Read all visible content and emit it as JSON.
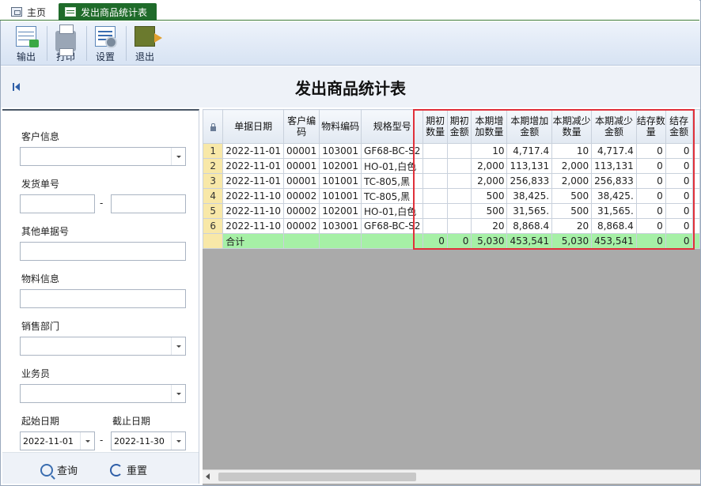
{
  "tabs": [
    {
      "label": "主页",
      "icon": "home-icon",
      "active": false
    },
    {
      "label": "发出商品统计表",
      "icon": "table-icon",
      "active": true
    }
  ],
  "toolbar": {
    "export_label": "输出",
    "print_label": "打印",
    "settings_label": "设置",
    "exit_label": "退出"
  },
  "page": {
    "title": "发出商品统计表"
  },
  "filters": {
    "customer_label": "客户信息",
    "delivery_no_label": "发货单号",
    "other_no_label": "其他单据号",
    "material_label": "物料信息",
    "dept_label": "销售部门",
    "salesman_label": "业务员",
    "start_date_label": "起始日期",
    "end_date_label": "截止日期",
    "start_date": "2022-11-01",
    "end_date": "2022-11-30",
    "range_sep": "-",
    "query_label": "查询",
    "reset_label": "重置"
  },
  "grid": {
    "headers": [
      "单据日期",
      "客户编码",
      "物料编码",
      "规格型号",
      "期初数量",
      "期初金额",
      "本期增加数量",
      "本期增加金额",
      "本期减少数量",
      "本期减少金额",
      "结存数量",
      "结存金额"
    ],
    "rows": [
      {
        "n": "1",
        "cells": [
          "2022-11-01",
          "00001",
          "103001",
          "GF68-BC-S2",
          "",
          "",
          "10",
          "4,717.4",
          "10",
          "4,717.4",
          "0",
          "0"
        ]
      },
      {
        "n": "2",
        "cells": [
          "2022-11-01",
          "00001",
          "102001",
          "HO-01,白色",
          "",
          "",
          "2,000",
          "113,131",
          "2,000",
          "113,131",
          "0",
          "0"
        ]
      },
      {
        "n": "3",
        "cells": [
          "2022-11-01",
          "00001",
          "101001",
          "TC-805,黑",
          "",
          "",
          "2,000",
          "256,833",
          "2,000",
          "256,833",
          "0",
          "0"
        ]
      },
      {
        "n": "4",
        "cells": [
          "2022-11-10",
          "00002",
          "101001",
          "TC-805,黑",
          "",
          "",
          "500",
          "38,425.",
          "500",
          "38,425.",
          "0",
          "0"
        ]
      },
      {
        "n": "5",
        "cells": [
          "2022-11-10",
          "00002",
          "102001",
          "HO-01,白色",
          "",
          "",
          "500",
          "31,565.",
          "500",
          "31,565.",
          "0",
          "0"
        ]
      },
      {
        "n": "6",
        "cells": [
          "2022-11-10",
          "00002",
          "103001",
          "GF68-BC-S2",
          "",
          "",
          "20",
          "8,868.4",
          "20",
          "8,868.4",
          "0",
          "0"
        ]
      }
    ],
    "total": {
      "cells": [
        "合计",
        "",
        "",
        "",
        "0",
        "0",
        "5,030",
        "453,541",
        "5,030",
        "453,541",
        "0",
        "0"
      ]
    }
  }
}
